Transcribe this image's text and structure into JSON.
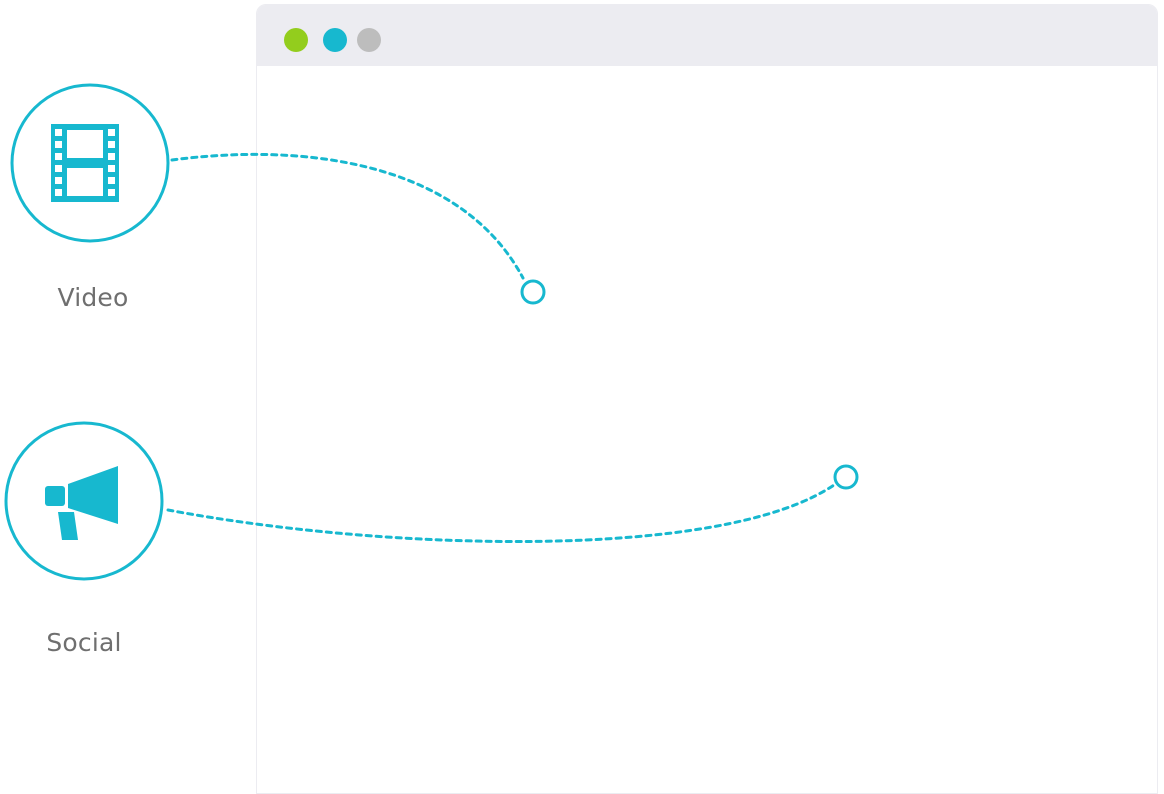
{
  "colors": {
    "accent": "#17b8cf",
    "dot_green": "#93cd1d",
    "dot_cyan": "#17b8cf",
    "dot_gray": "#bdbdbd",
    "titlebar": "#ececf1",
    "label_text": "#6f6f6f"
  },
  "browser": {
    "dots": [
      "green",
      "cyan",
      "gray"
    ]
  },
  "channels": [
    {
      "label": "Video",
      "icon": "film-strip-icon"
    },
    {
      "label": "Social",
      "icon": "megaphone-icon"
    }
  ]
}
